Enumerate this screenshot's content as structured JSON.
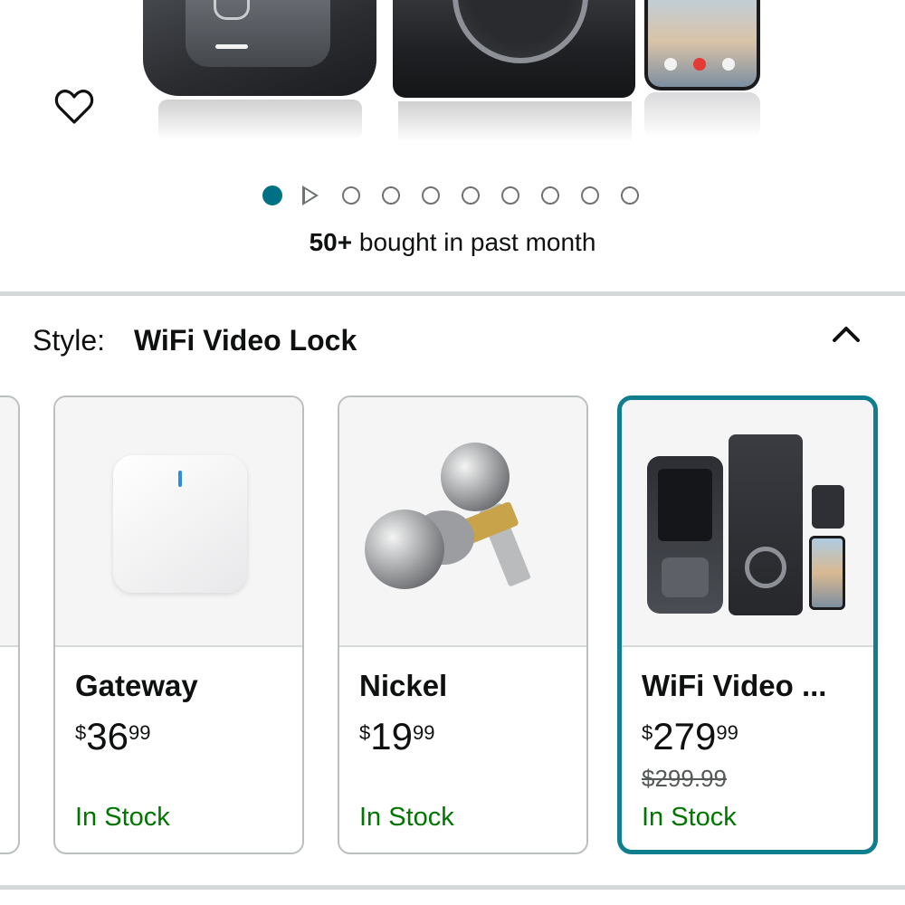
{
  "gallery": {
    "dot_count": 10,
    "active_index": 0,
    "has_video": true
  },
  "social_proof": {
    "count": "50+",
    "text": "bought in past month"
  },
  "style_selector": {
    "label": "Style:",
    "selected_value": "WiFi Video Lock",
    "expanded": true
  },
  "options": [
    {
      "name": "Gateway",
      "currency": "$",
      "price_whole": "36",
      "price_fraction": "99",
      "list_price": "",
      "availability": "In Stock",
      "selected": false
    },
    {
      "name": "Nickel",
      "currency": "$",
      "price_whole": "19",
      "price_fraction": "99",
      "list_price": "",
      "availability": "In Stock",
      "selected": false
    },
    {
      "name": "WiFi Video ...",
      "currency": "$",
      "price_whole": "279",
      "price_fraction": "99",
      "list_price": "$299.99",
      "availability": "In Stock",
      "selected": true
    }
  ],
  "colors": {
    "accent_teal": "#007185",
    "selected_border": "#0f7f8f",
    "in_stock_green": "#007600",
    "divider": "#d5d9d9"
  },
  "icons": {
    "wishlist": "heart-outline-icon",
    "collapse": "chevron-up-icon",
    "video": "play-icon"
  }
}
